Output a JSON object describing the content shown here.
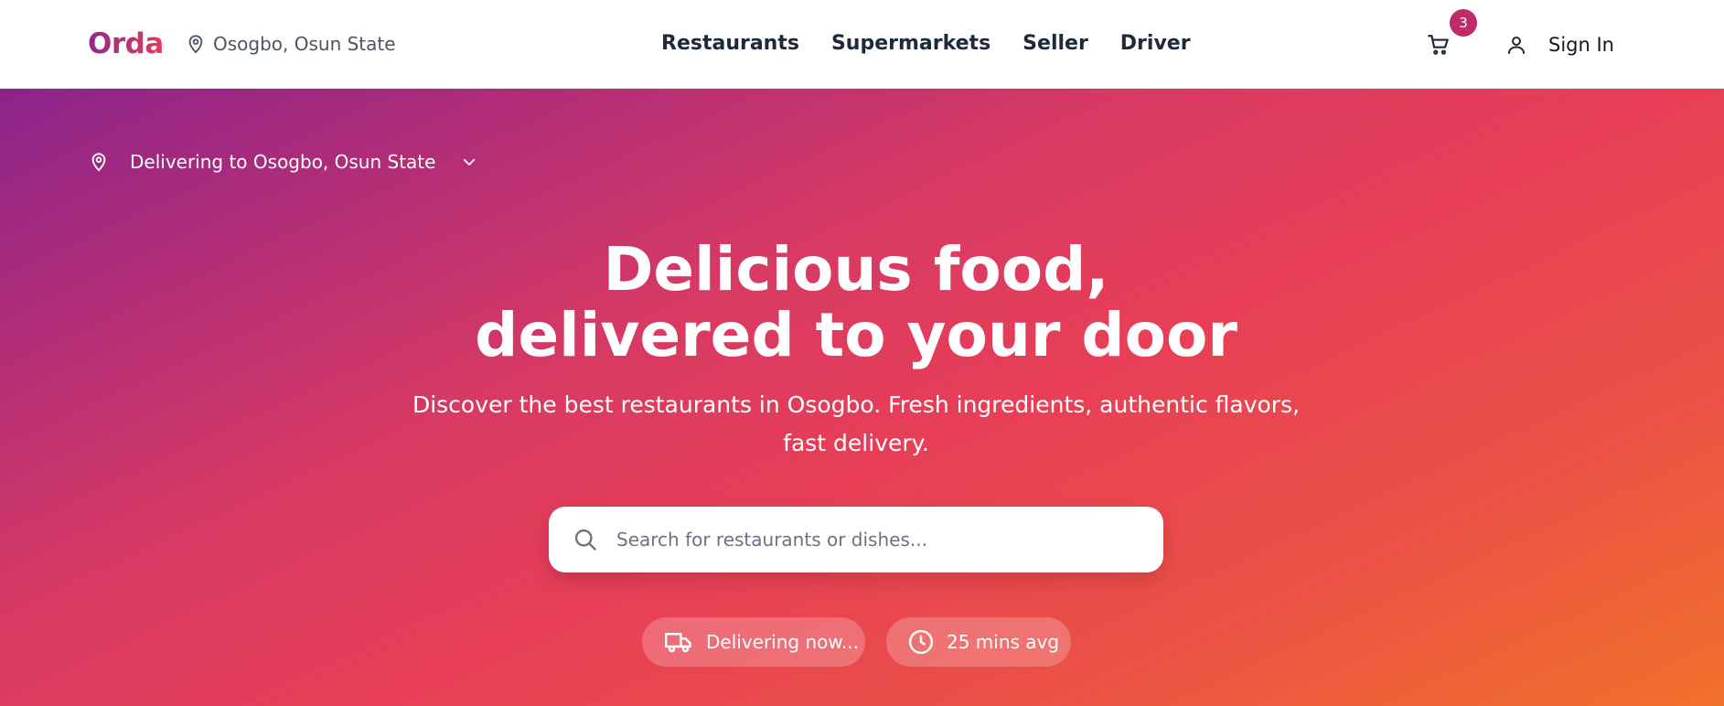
{
  "header": {
    "logo": "Orda",
    "location": "Osogbo, Osun State",
    "nav": [
      "Restaurants",
      "Supermarkets",
      "Seller",
      "Driver"
    ],
    "cart_count": "3",
    "signin_label": "Sign In"
  },
  "hero": {
    "delivering_to": "Delivering to Osogbo, Osun State",
    "headline_line1": "Delicious food,",
    "headline_line2": "delivered to your door",
    "subtitle": "Discover the best restaurants in Osogbo. Fresh ingredients, authentic flavors, fast delivery.",
    "search_placeholder": "Search for restaurants or dishes...",
    "pill_delivering": "Delivering now...",
    "pill_time": "25 mins avg"
  },
  "icons": {
    "location": "map-pin-icon",
    "cart": "shopping-cart-icon",
    "user": "user-icon",
    "chevron": "chevron-down-icon",
    "search": "search-icon",
    "truck": "truck-icon",
    "clock": "clock-icon"
  },
  "colors": {
    "brand_start": "#8e2a8b",
    "brand_end": "#e63a5e",
    "hero_gradient_end": "#f0712a",
    "badge": "#c02a6a"
  }
}
